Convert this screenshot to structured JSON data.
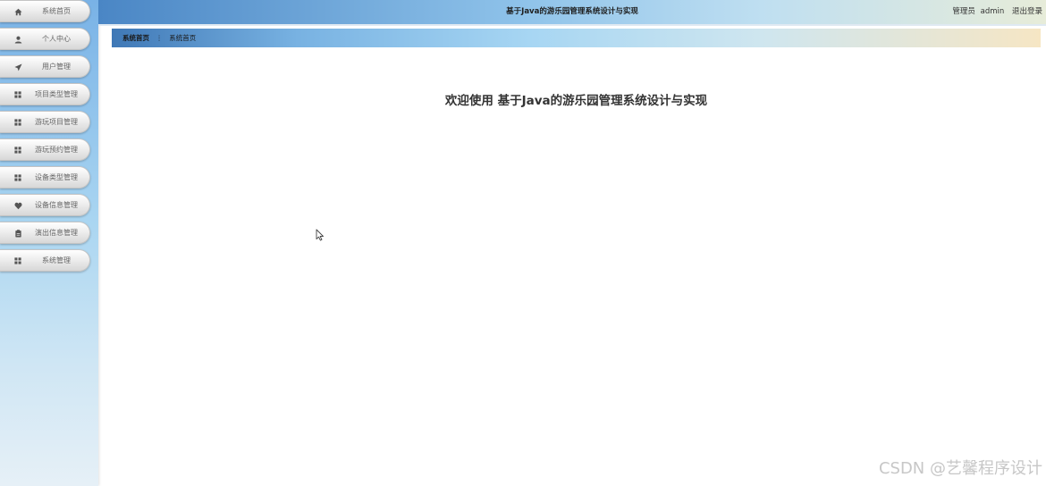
{
  "sidebar": {
    "items": [
      {
        "label": "系统首页",
        "icon": "home-icon"
      },
      {
        "label": "个人中心",
        "icon": "user-icon"
      },
      {
        "label": "用户管理",
        "icon": "send-icon"
      },
      {
        "label": "项目类型管理",
        "icon": "grid-icon"
      },
      {
        "label": "游玩项目管理",
        "icon": "grid-icon"
      },
      {
        "label": "游玩预约管理",
        "icon": "grid-icon"
      },
      {
        "label": "设备类型管理",
        "icon": "grid-icon"
      },
      {
        "label": "设备信息管理",
        "icon": "heart-icon"
      },
      {
        "label": "演出信息管理",
        "icon": "clipboard-icon"
      },
      {
        "label": "系统管理",
        "icon": "grid-icon"
      }
    ]
  },
  "header": {
    "title": "基于Java的游乐园管理系统设计与实现",
    "user_role": "管理员",
    "username": "admin",
    "logout": "退出登录"
  },
  "breadcrumb": {
    "home": "系统首页",
    "separator": "⋮",
    "current": "系统首页"
  },
  "main": {
    "welcome": "欢迎使用 基于Java的游乐园管理系统设计与实现"
  },
  "watermark": "CSDN @艺馨程序设计",
  "colors": {
    "header_start": "#4a86c5",
    "header_end": "#e7ecd9",
    "sidebar_top": "#79b2e6",
    "nav_icon": "#555555"
  }
}
